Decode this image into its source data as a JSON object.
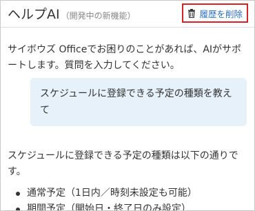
{
  "header": {
    "title": "ヘルプAI",
    "subtitle": "（開発中の新機能）",
    "clear_history_label": "履歴を削除"
  },
  "conversation": {
    "ai_greeting": "サイボウズ Officeでお困りのことがあれば、AIがサポートします。質問を入力してください。",
    "user_question": "スケジュールに登録できる予定の種類を教えて",
    "ai_answer": "スケジュールに登録できる予定の種類は以下の通りです。",
    "answer_items": [
      "通常予定（1日内／時刻未設定も可能）",
      "期間予定（開始日・終了日のみ設定）"
    ]
  },
  "colors": {
    "accent": "#2a6fc9",
    "highlight_border": "#e02020",
    "user_bubble": "#e6f1fa"
  },
  "icons": {
    "clear_history": "trash-icon"
  }
}
